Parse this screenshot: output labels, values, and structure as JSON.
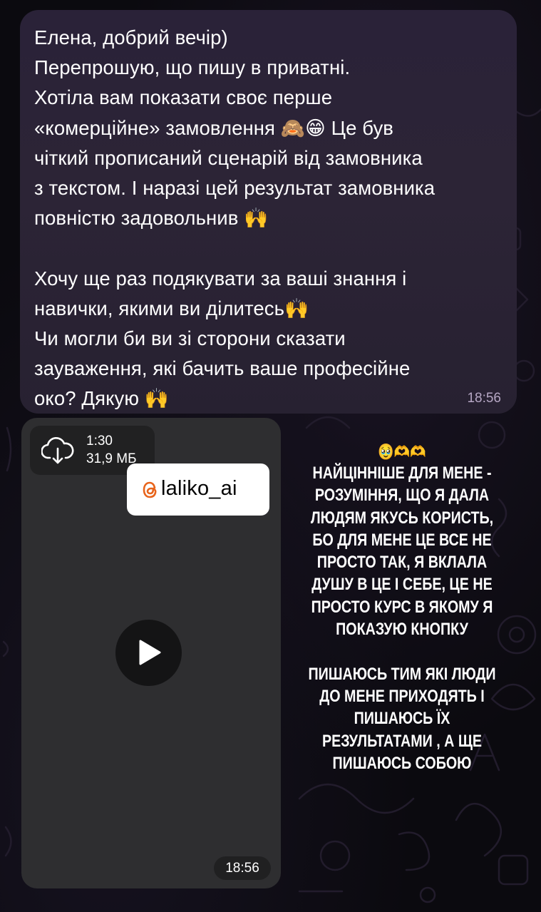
{
  "message": {
    "lines": [
      "Елена, добрий вечір)",
      "Перепрошую, що пишу в приватні.",
      "Хотіла вам показати своє перше",
      "«комерційне» замовлення 🙈😁 Це був",
      "чіткий прописаний сценарій від замовника",
      "з текстом. І наразі цей результат замовника",
      "повністю задовольнив 🙌",
      "",
      "Хочу ще раз подякувати за ваші знання і",
      "навички, якими ви ділитесь🙌",
      "Чи могли би ви зі сторони сказати",
      "зауваження, які бачить ваше професійне",
      "око? Дякую 🙌"
    ],
    "time": "18:56"
  },
  "video": {
    "duration": "1:30",
    "size": "31,9 МБ",
    "time": "18:56",
    "download_icon": "cloud-download-icon",
    "play_icon": "play-icon"
  },
  "handle": {
    "text": "laliko_ai",
    "logo_icon": "threads-logo-icon"
  },
  "story": {
    "emoji": "🥹🫶🫶",
    "lines": [
      "НАЙЦІННІШЕ ДЛЯ МЕНЕ -",
      "РОЗУМІННЯ, ЩО Я ДАЛА",
      "ЛЮДЯМ ЯКУСЬ КОРИСТЬ,",
      "БО ДЛЯ МЕНЕ ЦЕ ВСЕ НЕ",
      "ПРОСТО ТАК, Я ВКЛАЛА",
      "ДУШУ В ЦЕ І СЕБЕ, ЦЕ НЕ",
      "ПРОСТО КУРС В ЯКОМУ Я",
      "ПОКАЗУЮ КНОПКУ",
      "",
      "ПИШАЮСЬ ТИМ ЯКІ ЛЮДИ",
      "ДО МЕНЕ ПРИХОДЯТЬ І",
      "ПИШАЮСЬ ЇХ",
      "РЕЗУЛЬТАТАМИ , А ЩЕ",
      "ПИШАЮСЬ СОБОЮ"
    ]
  },
  "colors": {
    "bubble": "#2a2238",
    "time_text": "#b6a7c4",
    "video_bg": "#2e2e30",
    "background": "#0b0a0f"
  }
}
